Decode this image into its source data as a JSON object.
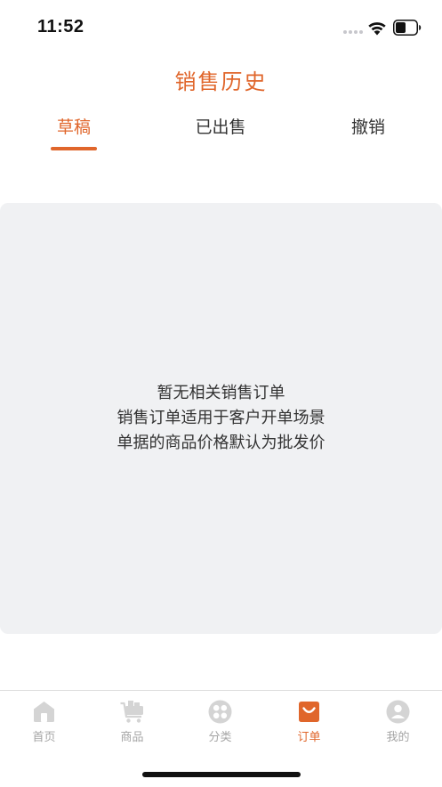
{
  "status_bar": {
    "time": "11:52"
  },
  "header": {
    "title": "销售历史"
  },
  "tabs": [
    {
      "label": "草稿",
      "active": true
    },
    {
      "label": "已出售",
      "active": false
    },
    {
      "label": "撤销",
      "active": false
    }
  ],
  "empty_state": {
    "lines": [
      "暂无相关销售订单",
      "销售订单适用于客户开单场景",
      "单据的商品价格默认为批发价"
    ]
  },
  "tabbar": {
    "items": [
      {
        "label": "首页",
        "icon": "home-icon",
        "active": false
      },
      {
        "label": "商品",
        "icon": "cart-icon",
        "active": false
      },
      {
        "label": "分类",
        "icon": "category-icon",
        "active": false
      },
      {
        "label": "订单",
        "icon": "order-bag-icon",
        "active": true
      },
      {
        "label": "我的",
        "icon": "profile-icon",
        "active": false
      }
    ]
  },
  "colors": {
    "accent": "#e0662b",
    "inactive_icon": "#d4d4d4",
    "panel_background": "#f0f1f3"
  }
}
